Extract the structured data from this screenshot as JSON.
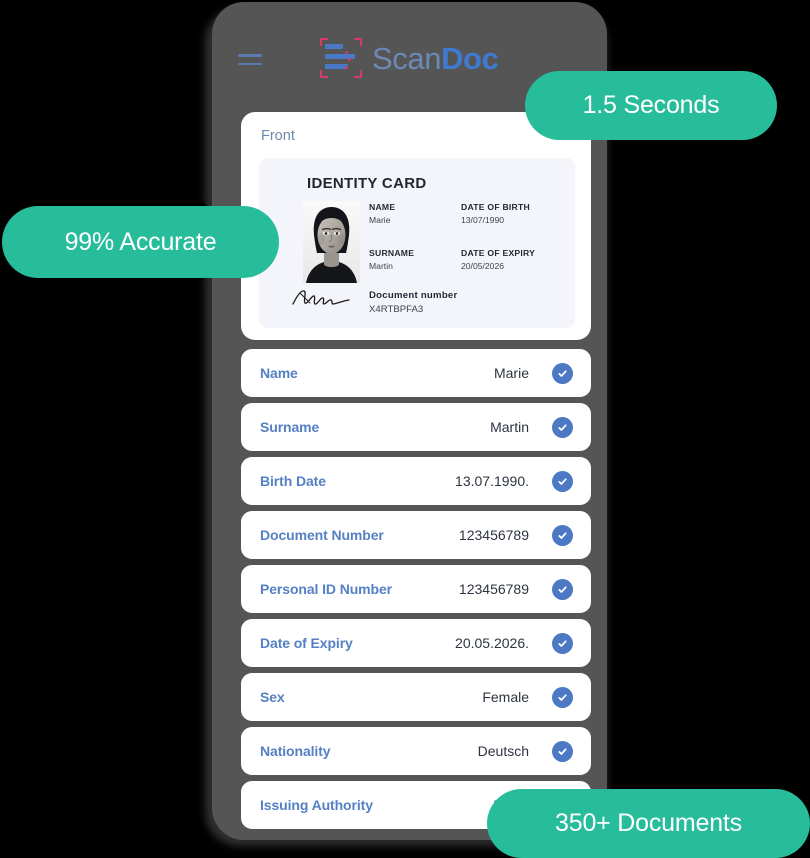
{
  "app": {
    "brand_scan": "Scan",
    "brand_doc": "Doc",
    "menu_icon": "hamburger-icon",
    "logo_icon": "scan-frame-document-icon"
  },
  "scan_panel": {
    "side_label": "Front",
    "card": {
      "title": "IDENTITY CARD",
      "photo_icon": "portrait-photo",
      "signature_icon": "handwritten-signature",
      "fields": [
        {
          "label": "NAME",
          "value": "Marie"
        },
        {
          "label": "DATE OF BIRTH",
          "value": "13/07/1990"
        },
        {
          "label": "SURNAME",
          "value": "Martin"
        },
        {
          "label": "DATE OF EXPIRY",
          "value": "20/05/2026"
        }
      ],
      "document_number": {
        "label": "Document number",
        "value": "X4RTBPFA3"
      }
    }
  },
  "extracted_rows": [
    {
      "label": "Name",
      "value": "Marie",
      "status": "verified"
    },
    {
      "label": "Surname",
      "value": "Martin",
      "status": "verified"
    },
    {
      "label": "Birth Date",
      "value": "13.07.1990.",
      "status": "verified"
    },
    {
      "label": "Document Number",
      "value": "123456789",
      "status": "verified"
    },
    {
      "label": "Personal ID Number",
      "value": "123456789",
      "status": "verified"
    },
    {
      "label": "Date of Expiry",
      "value": "20.05.2026.",
      "status": "verified"
    },
    {
      "label": "Sex",
      "value": "Female",
      "status": "verified"
    },
    {
      "label": "Nationality",
      "value": "Deutsch",
      "status": "verified"
    },
    {
      "label": "Issuing Authority",
      "value": "Berlin",
      "status": "verified"
    }
  ],
  "badges": {
    "speed": "1.5 Seconds",
    "accuracy": "99% Accurate",
    "documents": "350+ Documents"
  },
  "colors": {
    "phone_frame": "#555555",
    "accent_green": "#27bd9a",
    "label_blue": "#5580c4",
    "brand_blue": "#3f7ad0",
    "brand_blue_light": "#6e88b4",
    "logo_red": "#d63a6a",
    "check_blue": "#4c78c4",
    "card_bg": "#f3f5fb",
    "page_bg": "#000000"
  }
}
